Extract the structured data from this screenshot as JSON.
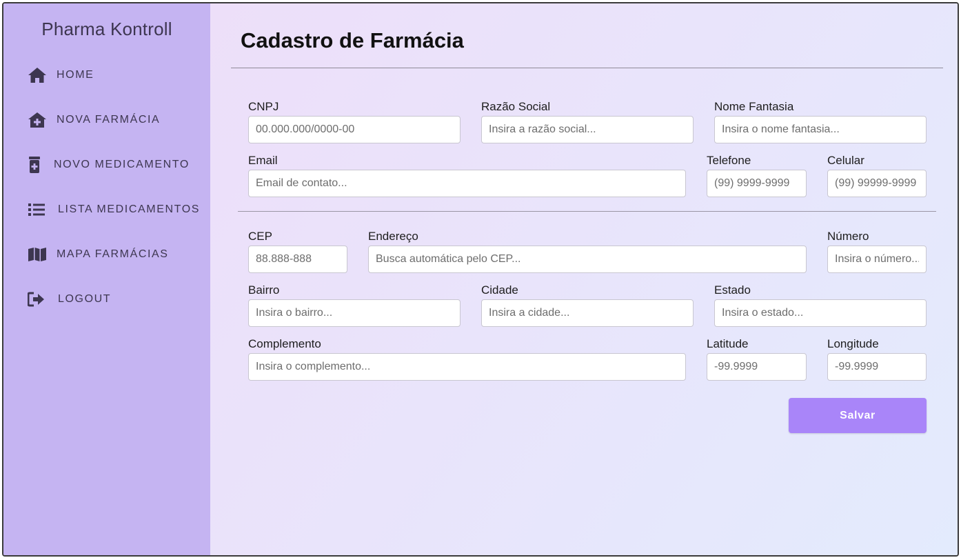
{
  "sidebar": {
    "brand": "Pharma Kontroll",
    "items": [
      {
        "label": "HOME",
        "icon": "home-icon"
      },
      {
        "label": "NOVA FARMÁCIA",
        "icon": "store-plus-icon"
      },
      {
        "label": "NOVO MEDICAMENTO",
        "icon": "medicine-bottle-icon"
      },
      {
        "label": "LISTA MEDICAMENTOS",
        "icon": "list-icon"
      },
      {
        "label": "MAPA FARMÁCIAS",
        "icon": "map-icon"
      },
      {
        "label": "LOGOUT",
        "icon": "logout-icon"
      }
    ]
  },
  "main": {
    "title": "Cadastro de Farmácia",
    "fields": {
      "cnpj": {
        "label": "CNPJ",
        "placeholder": "00.000.000/0000-00"
      },
      "razao_social": {
        "label": "Razão Social",
        "placeholder": "Insira a razão social..."
      },
      "nome_fantasia": {
        "label": "Nome Fantasia",
        "placeholder": "Insira o nome fantasia..."
      },
      "email": {
        "label": "Email",
        "placeholder": "Email de contato..."
      },
      "telefone": {
        "label": "Telefone",
        "placeholder": "(99) 9999-9999"
      },
      "celular": {
        "label": "Celular",
        "placeholder": "(99) 99999-9999"
      },
      "cep": {
        "label": "CEP",
        "placeholder": "88.888-888"
      },
      "endereco": {
        "label": "Endereço",
        "placeholder": "Busca automática pelo CEP..."
      },
      "numero": {
        "label": "Número",
        "placeholder": "Insira o número..."
      },
      "bairro": {
        "label": "Bairro",
        "placeholder": "Insira o bairro..."
      },
      "cidade": {
        "label": "Cidade",
        "placeholder": "Insira a cidade..."
      },
      "estado": {
        "label": "Estado",
        "placeholder": "Insira o estado..."
      },
      "complemento": {
        "label": "Complemento",
        "placeholder": "Insira o complemento..."
      },
      "latitude": {
        "label": "Latitude",
        "placeholder": "-99.9999"
      },
      "longitude": {
        "label": "Longitude",
        "placeholder": "-99.9999"
      }
    },
    "save_label": "Salvar"
  },
  "colors": {
    "sidebar_bg": "#c5b4f2",
    "accent_button": "#a985f9",
    "nav_text": "#3d3650"
  }
}
